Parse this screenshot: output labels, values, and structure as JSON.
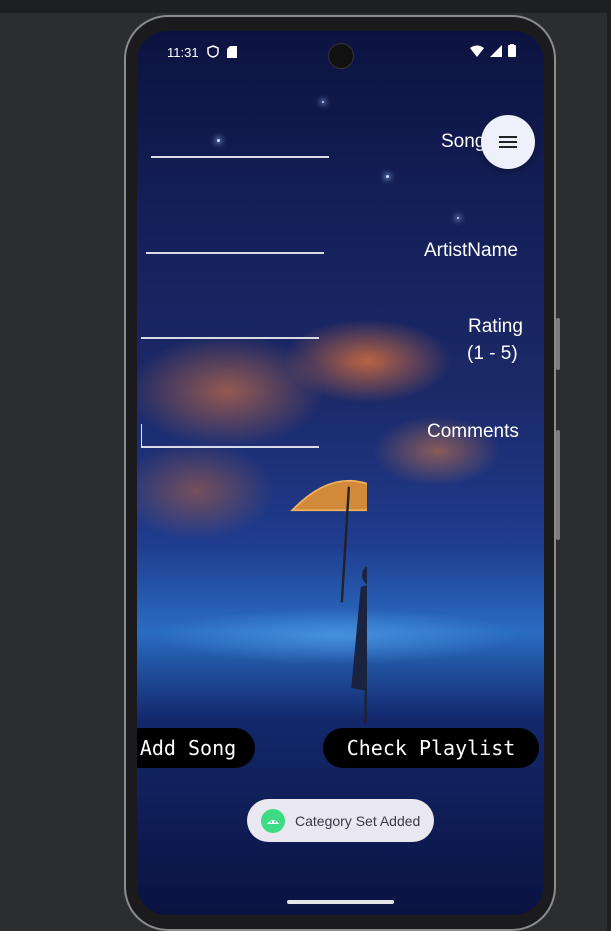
{
  "status_bar": {
    "time": "11:31",
    "icons": [
      "shield-icon",
      "sd-card-icon",
      "wifi-icon",
      "signal-icon",
      "battery-icon"
    ]
  },
  "form": {
    "song_label": "Song",
    "artist_label": "ArtistName",
    "rating_label": "Rating",
    "rating_range": "(1 - 5)",
    "comments_label": "Comments"
  },
  "menu_fab": {
    "icon": "menu-icon"
  },
  "buttons": {
    "add_song": "Add Song",
    "check_playlist": "Check Playlist"
  },
  "toast": {
    "icon": "android-icon",
    "message": "Category Set Added"
  },
  "colors": {
    "button_bg": "#000000",
    "toast_bg": "#e9e8f0",
    "fab_bg": "#eef1fb"
  }
}
